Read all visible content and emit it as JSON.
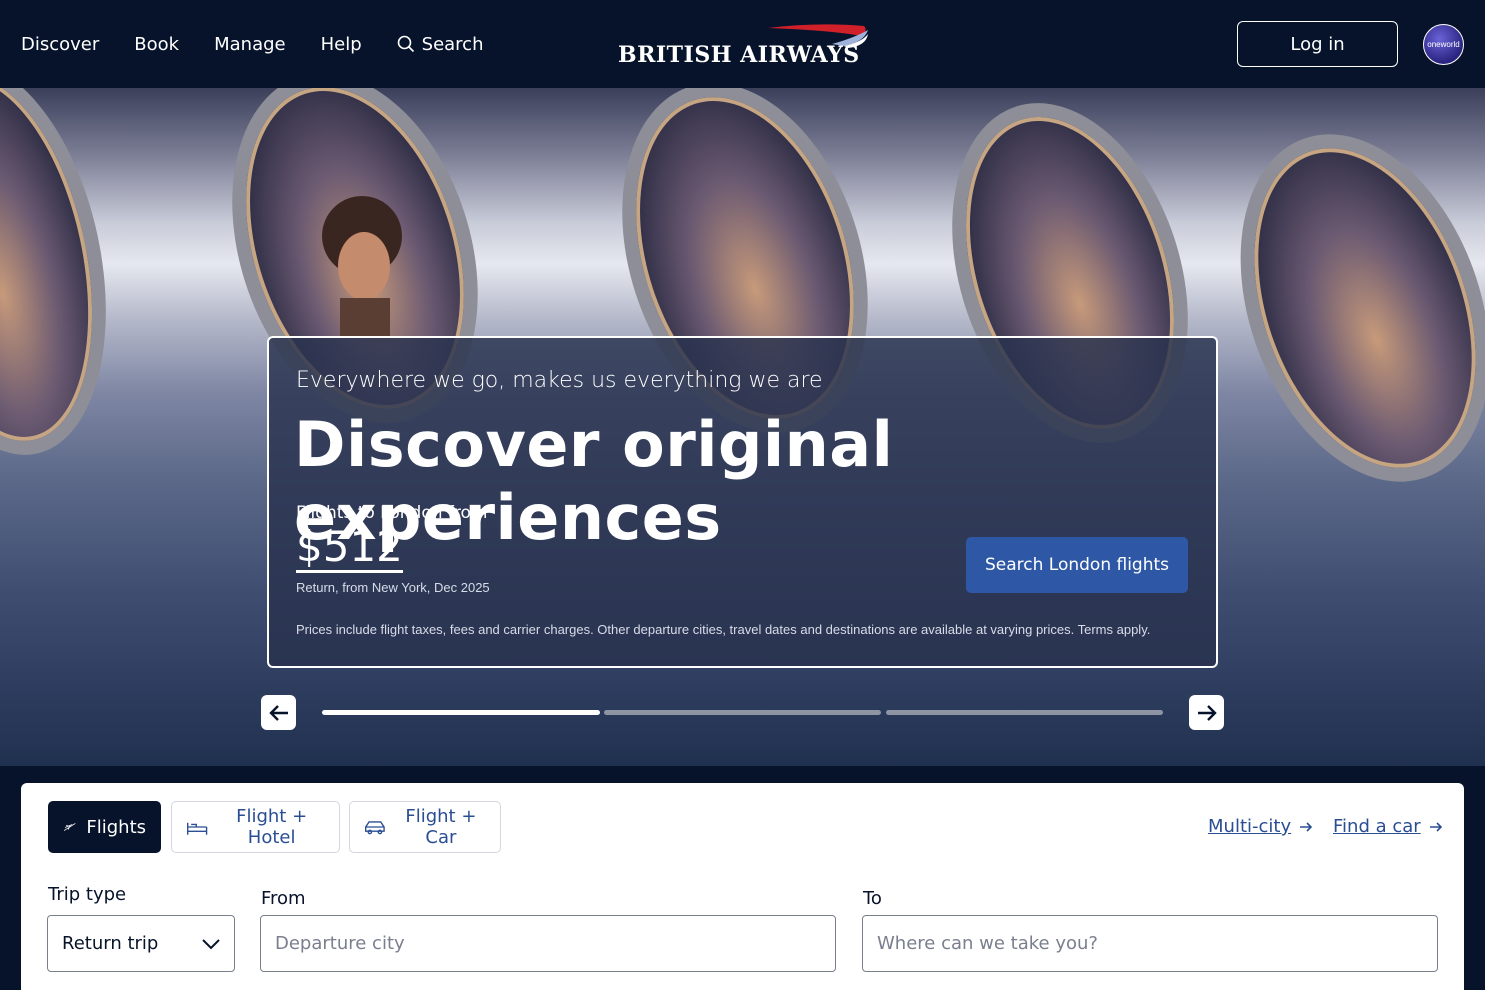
{
  "header": {
    "nav": [
      "Discover",
      "Book",
      "Manage",
      "Help"
    ],
    "search_label": "Search",
    "logo_text": "BRITISH AIRWAYS",
    "login_label": "Log in",
    "oneworld_text": "oneworld"
  },
  "hero": {
    "tagline": "Everywhere we go, makes us everything we are",
    "headline": "Discover original experiences",
    "price_label": "Flights to London from",
    "price": "$512",
    "price_sub": "Return, from New York, Dec 2025",
    "cta_label": "Search London flights",
    "disclaimer": "Prices include flight taxes, fees and carrier charges. Other departure cities, travel dates and destinations are available at varying prices. Terms apply.",
    "carousel_active_slide": 1,
    "carousel_slide_count": 3
  },
  "booking": {
    "tabs": [
      "Flights",
      "Flight + Hotel",
      "Flight + Car"
    ],
    "links": [
      "Multi-city",
      "Find a car"
    ],
    "trip_type_label": "Trip type",
    "trip_type_value": "Return trip",
    "from_label": "From",
    "from_placeholder": "Departure city",
    "to_label": "To",
    "to_placeholder": "Where can we take you?"
  },
  "colors": {
    "navy": "#07132a",
    "accent_blue": "#2e58a6",
    "link_blue": "#2a4e93",
    "brand_red": "#d0202a"
  }
}
